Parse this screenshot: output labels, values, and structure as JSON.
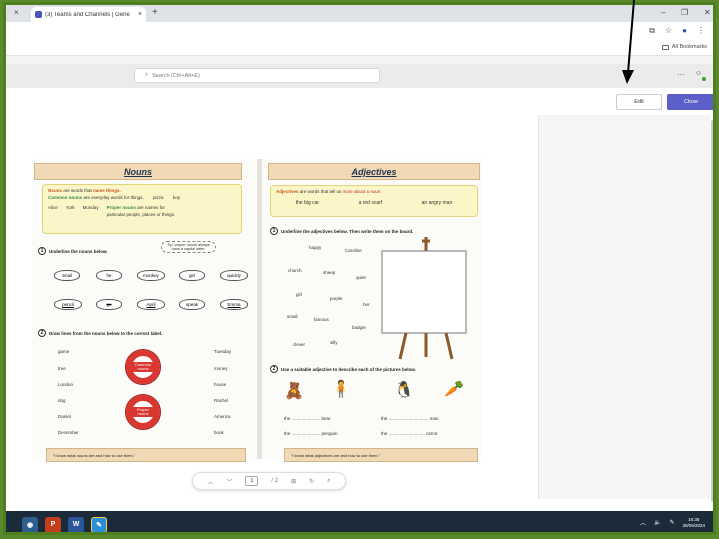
{
  "browser": {
    "tab_title": "(3) Teams and Channels | Gene",
    "tab_close": "×",
    "new_tab": "+",
    "strip_close": "×",
    "minimize": "–",
    "maximize": "❐",
    "window_close": "✕",
    "all_bookmarks": "All Bookmarks"
  },
  "teams": {
    "search_placeholder": "Search (Ctrl+Alt+E)",
    "more": "···",
    "edit_label": "Edit",
    "close_label": "Close"
  },
  "worksheet": {
    "nouns": {
      "title": "Nouns",
      "def1_a": "Nouns",
      "def1_b": " are words that ",
      "def1_c": "name things.",
      "def2_a": "Common nouns",
      "def2_b": " are everyday words for things.",
      "def2_ex1": "pizza",
      "def2_ex2": "boy",
      "proper_examples": [
        "Alice",
        "York",
        "Monday"
      ],
      "proper_def_a": "Proper nouns",
      "proper_def_b": " are names for particular people, places or things.",
      "tip": "Tip: proper nouns always have a capital letter.",
      "q1_num": "1",
      "q1": "Underline the nouns below.",
      "bubbles_row1": [
        "Snail",
        "he",
        "monkey",
        "girl",
        "quickly"
      ],
      "bubbles_row2": [
        "pencil",
        "go",
        "April",
        "speak",
        "Emma"
      ],
      "q2_num": "2",
      "q2": "Draw lines from the nouns below to the correct label.",
      "left_words": [
        "game",
        "tree",
        "London",
        "dog",
        "Daniel",
        "December"
      ],
      "right_words": [
        "Tuesday",
        "money",
        "house",
        "Rachel",
        "America",
        "book"
      ],
      "ring1": "Common nouns",
      "ring2": "Proper nouns",
      "footer": "\"I know what nouns are and how to use them.\""
    },
    "adjectives": {
      "title": "Adjectives",
      "def_a": "Adjectives",
      "def_b": " are words that tell us ",
      "def_c": "more about a noun.",
      "examples": [
        "the big car",
        "a red scarf",
        "an angry man"
      ],
      "q1_num": "1",
      "q1": "Underline the adjectives below. Then write them on the board.",
      "words": [
        "happy",
        "Caroline",
        "church",
        "sheep",
        "quiet",
        "girl",
        "purple",
        "her",
        "small",
        "famous",
        "badger",
        "clever",
        "silly"
      ],
      "q2_num": "2",
      "q2": "Use a suitable adjective to describe each of the pictures below.",
      "line1_a": "the ....................... bear",
      "line1_b": "the ................................ man",
      "line2_a": "the ....................... penguin",
      "line2_b": "the ............................. carrot",
      "footer": "\"I know what adjectives are and how to use them.\""
    }
  },
  "pdf_toolbar": {
    "page_current": "1",
    "page_total": "/ 2"
  },
  "taskbar": {
    "time": "16:36",
    "date": "30/09/2024"
  }
}
